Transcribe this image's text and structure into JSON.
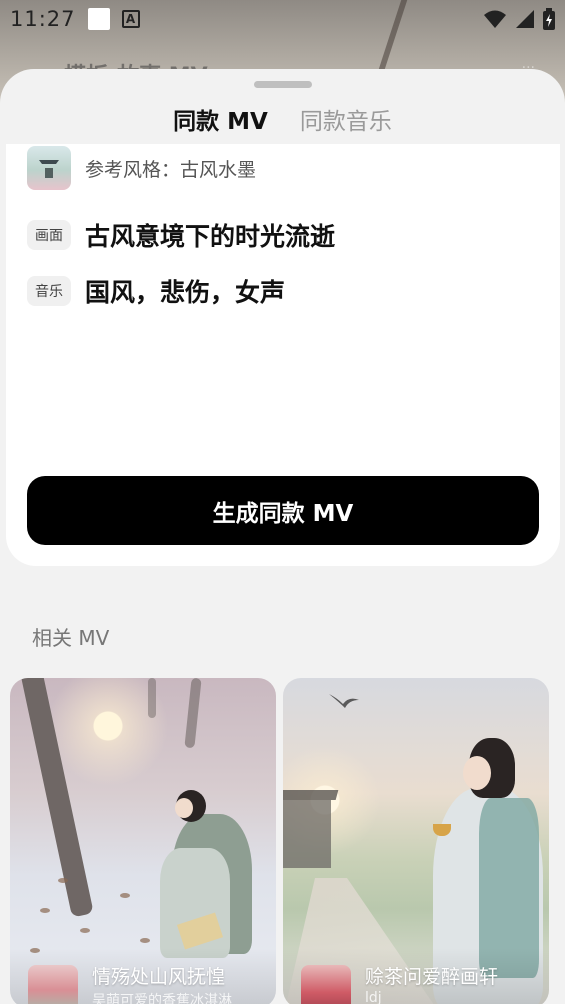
{
  "status_bar": {
    "time": "11:27",
    "icons": [
      "notification-square-icon",
      "a-notification-icon",
      "wifi-icon",
      "signal-icon",
      "battery-icon"
    ]
  },
  "background_app": {
    "title": "模板-故事 MV",
    "subtitle": "···"
  },
  "sheet": {
    "tabs": [
      {
        "label": "同款 MV",
        "active": true
      },
      {
        "label": "同款音乐",
        "active": false
      }
    ],
    "reference": {
      "text": "参考风格：古风水墨",
      "thumb_icon": "ink-landscape-pavilion-thumb"
    },
    "scene": {
      "tag": "画面",
      "text": "古风意境下的时光流逝"
    },
    "music": {
      "tag": "音乐",
      "text": "国风，悲伤，女声"
    },
    "generate_button": "生成同款 MV"
  },
  "related": {
    "title": "相关 MV",
    "items": [
      {
        "title": "情殇处山风抚惶",
        "subtitle": "吴萌可爱的香蕉冰淇淋",
        "image": "woman-kneeling-under-tree-winter-sunrise"
      },
      {
        "title": "赊茶问爱醉画轩",
        "subtitle": "ldj",
        "image": "woman-holding-teacup-field-sunset"
      }
    ]
  },
  "colors": {
    "primary_button": "#000000",
    "tab_active": "#111111",
    "tab_inactive": "#9a9a9a",
    "sheet_bg": "#f2f2f2",
    "card_bg": "#ffffff"
  }
}
